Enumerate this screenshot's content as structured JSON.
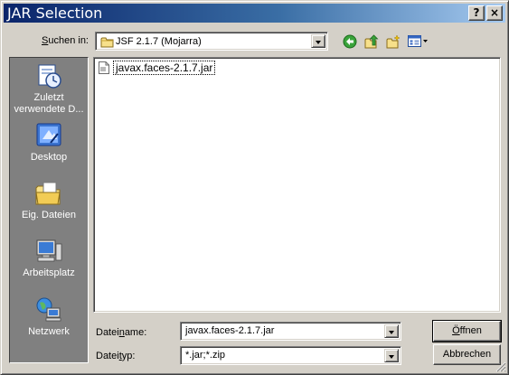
{
  "window": {
    "title": "JAR Selection",
    "help_label": "?",
    "close_label": "×"
  },
  "lookin": {
    "label_pre": "",
    "label_accel": "S",
    "label_post": "uchen in:",
    "value": "JSF 2.1.7 (Mojarra)"
  },
  "toolbar": {
    "icons": [
      "back-icon",
      "up-folder-icon",
      "new-folder-icon",
      "view-menu-icon"
    ]
  },
  "places": [
    {
      "label": "Zuletzt verwendete D...",
      "line1": "Zuletzt",
      "line2": "verwendete D...",
      "icon": "recent-documents-icon"
    },
    {
      "label": "Desktop",
      "icon": "desktop-icon"
    },
    {
      "label": "Eig. Dateien",
      "icon": "my-documents-icon"
    },
    {
      "label": "Arbeitsplatz",
      "icon": "my-computer-icon"
    },
    {
      "label": "Netzwerk",
      "icon": "network-icon"
    }
  ],
  "files": [
    {
      "name": "javax.faces-2.1.7.jar",
      "icon": "jar-file-icon"
    }
  ],
  "filename": {
    "label_pre": "Datei",
    "label_accel": "n",
    "label_post": "ame:",
    "value": "javax.faces-2.1.7.jar"
  },
  "filetype": {
    "label_pre": "Datei",
    "label_accel": "t",
    "label_post": "yp:",
    "value": "*.jar;*.zip"
  },
  "buttons": {
    "open_accel": "Ö",
    "open_rest": "ffnen",
    "cancel": "Abbrechen"
  },
  "colors": {
    "titlebar_start": "#0a246a",
    "titlebar_end": "#a6caf0",
    "face": "#d4d0c8",
    "places_bar": "#808080"
  }
}
